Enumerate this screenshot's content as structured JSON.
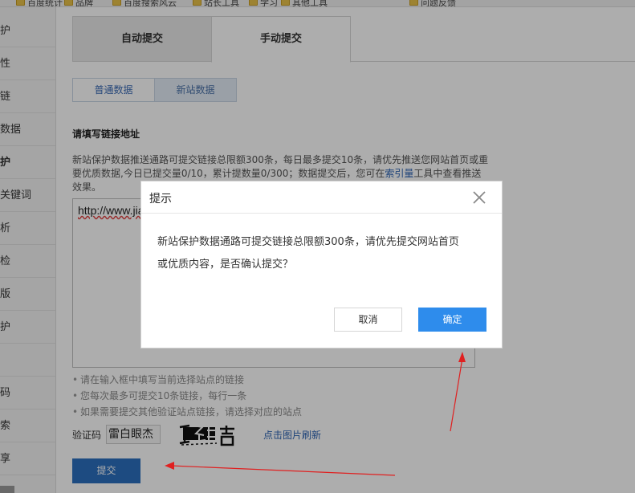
{
  "bookmarks": [
    {
      "label": "百度统计",
      "icon": "folder-icon"
    },
    {
      "label": "品牌",
      "icon": "folder-icon"
    },
    {
      "label": "百度搜索风云",
      "icon": "folder-icon"
    },
    {
      "label": "站长工具",
      "icon": "folder-icon"
    },
    {
      "label": "学习",
      "icon": "folder-icon"
    },
    {
      "label": "其他工具",
      "icon": "folder-icon"
    },
    {
      "label": "问题反馈",
      "icon": "folder-icon"
    }
  ],
  "sidebar": {
    "items": [
      {
        "label": "护"
      },
      {
        "label": "性"
      },
      {
        "label": "链"
      },
      {
        "label": "数据"
      },
      {
        "label": "护"
      },
      {
        "label": "关键词"
      },
      {
        "label": "析"
      },
      {
        "label": "检"
      },
      {
        "label": "版"
      },
      {
        "label": "护"
      },
      {
        "label": ""
      },
      {
        "label": "码"
      },
      {
        "label": "索"
      },
      {
        "label": "享"
      }
    ],
    "active_index": 4
  },
  "main": {
    "tabs": {
      "auto": "自动提交",
      "manual": "手动提交"
    },
    "sub_tabs": {
      "normal": "普通数据",
      "new_site": "新站数据"
    },
    "section_title": "请填写链接地址",
    "description": {
      "part1": "新站保护数据推送通路可提交链接总限额300条，每日最多提交10条，请优先推送您网站首页或重要优质数据,今日已提交量0/10，累计提数量0/300；数据提交后，您可在",
      "link": "索引量",
      "part2": "工具中查看推送效果。"
    },
    "url_text": "http://www.jia",
    "tips": [
      "请在输入框中填写当前选择站点的链接",
      "您每次最多可提交10条链接，每行一条",
      "如果需要提交其他验证站点链接，请选择对应的站点"
    ],
    "captcha": {
      "label": "验证码",
      "value": "雷白眼杰",
      "refresh_link": "点击图片刷新"
    },
    "submit_label": "提交"
  },
  "dialog": {
    "title": "提示",
    "body_line1": "新站保护数据通路可提交链接总限额300条，请优先提交网站首页",
    "body_line2": "或优质内容，是否确认提交？",
    "cancel_label": "取消",
    "confirm_label": "确定"
  },
  "colors": {
    "primary_blue": "#2e8cec",
    "submit_blue": "#2c6fbf",
    "link_blue": "#2d64b3",
    "annotation_red": "#e02020"
  }
}
